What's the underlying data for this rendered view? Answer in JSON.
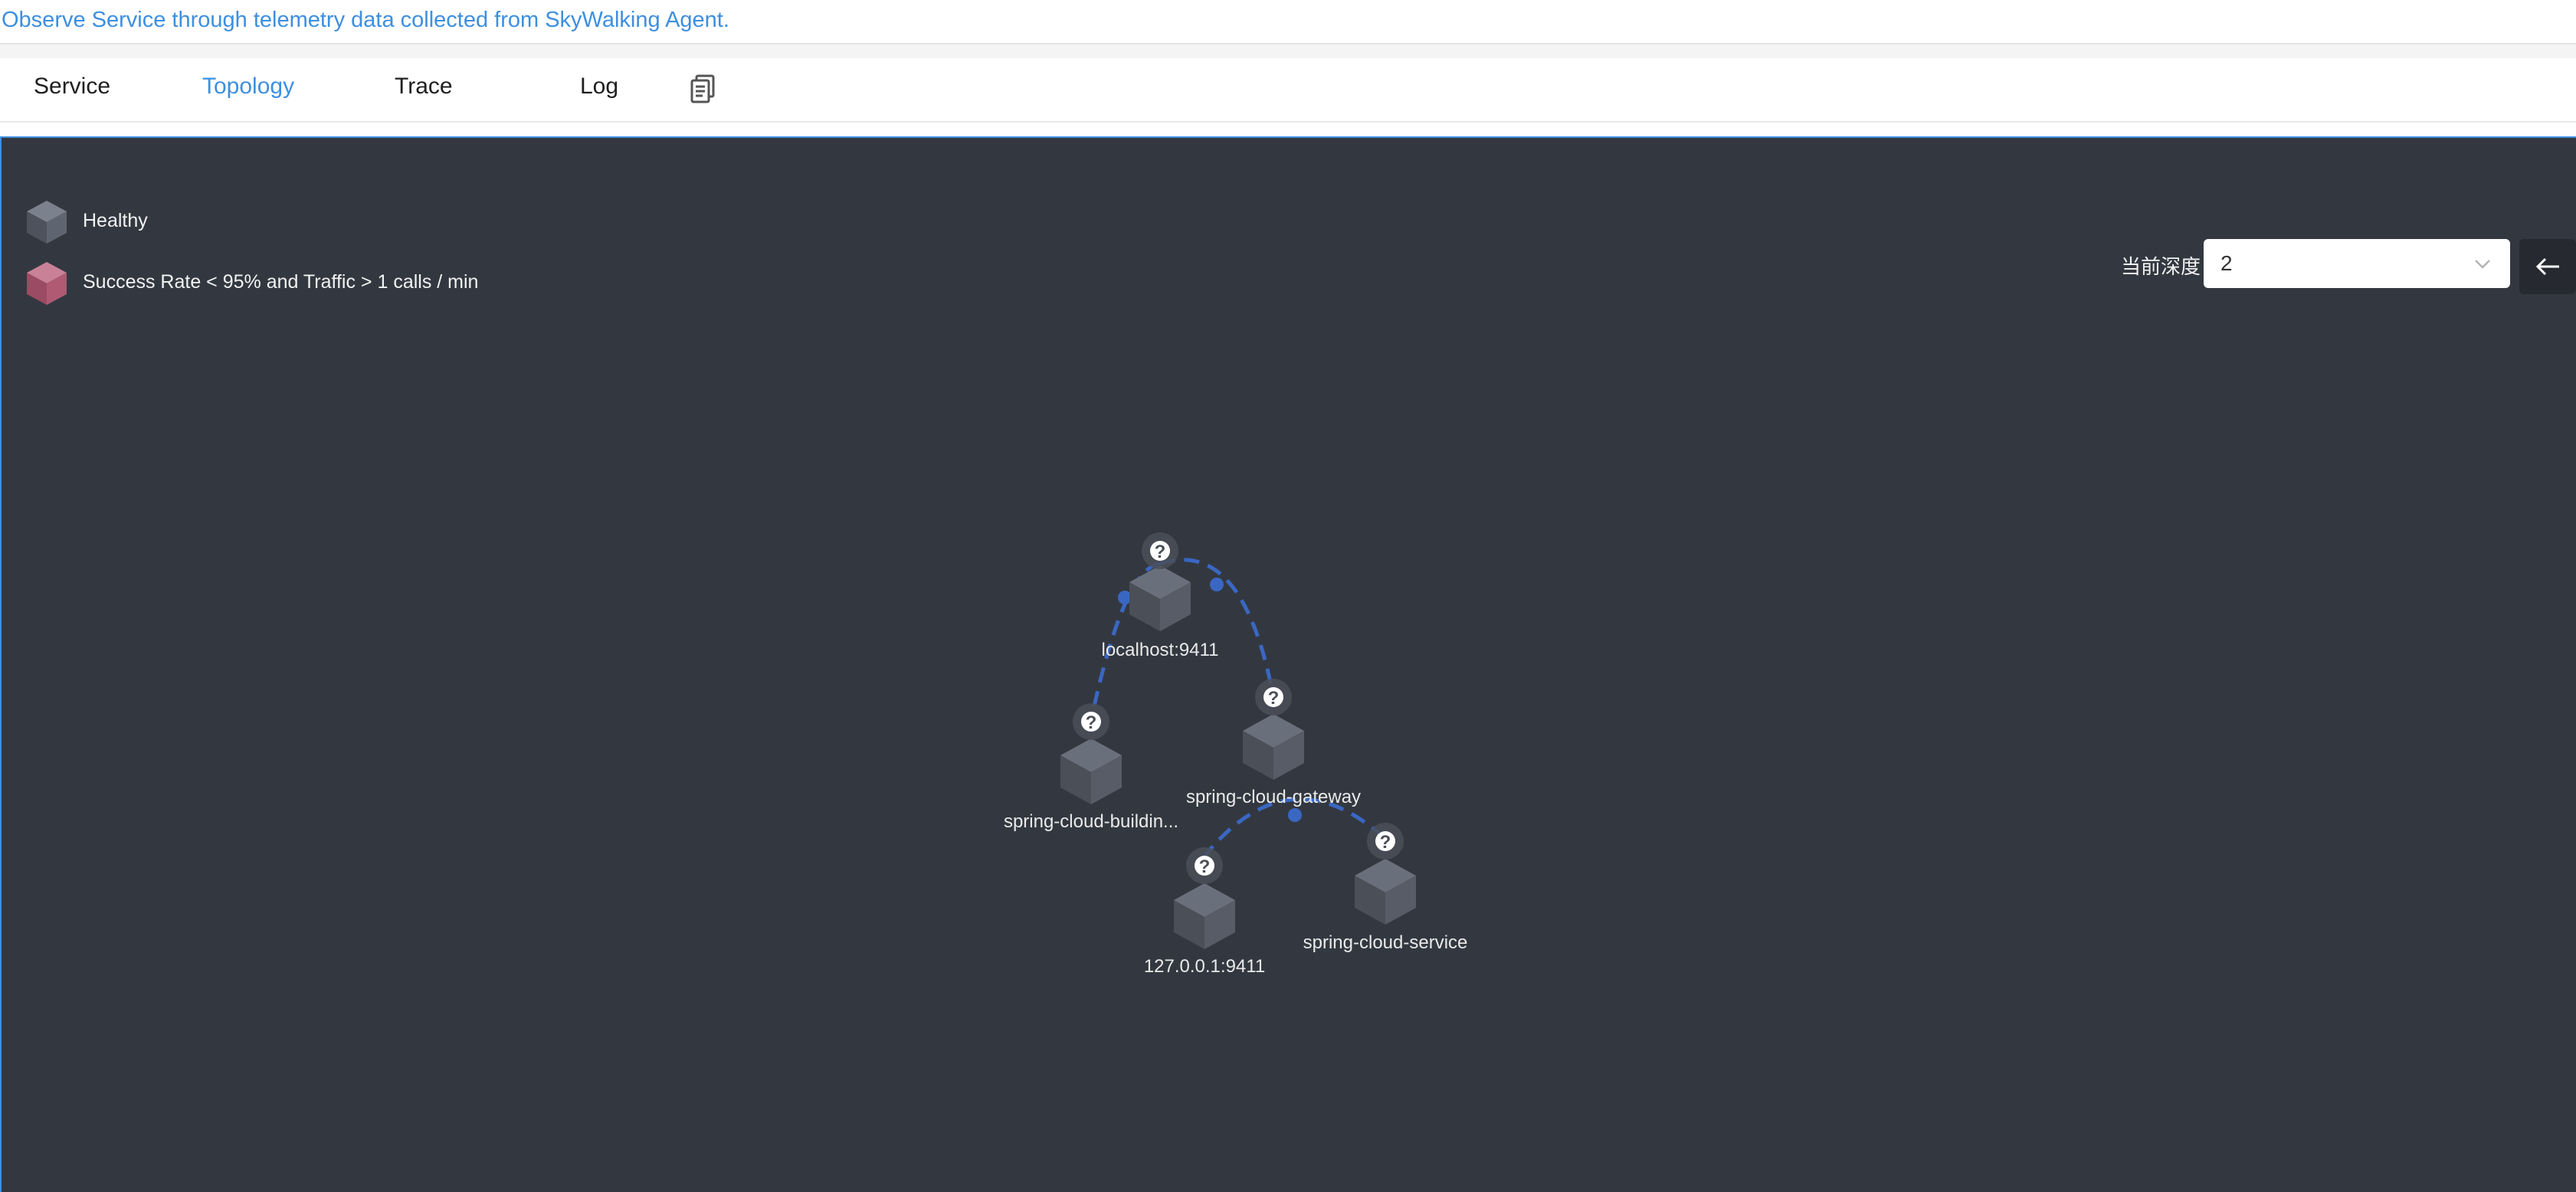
{
  "header": {
    "description": "Observe Service through telemetry data collected from SkyWalking Agent."
  },
  "tabs": [
    {
      "label": "Service",
      "active": false
    },
    {
      "label": "Topology",
      "active": true
    },
    {
      "label": "Trace",
      "active": false
    },
    {
      "label": "Log",
      "active": false
    }
  ],
  "tab_icon": "copy-document-icon",
  "legend": {
    "healthy": {
      "label": "Healthy",
      "color": "#5d6370"
    },
    "unhealthy": {
      "label": "Success Rate < 95% and Traffic > 1 calls / min",
      "color": "#b05a74"
    }
  },
  "depth": {
    "label": "当前深度",
    "value": "2"
  },
  "back_button": {
    "icon": "arrow-left-icon"
  },
  "topology": {
    "nodes": [
      {
        "id": "localhost",
        "label": "localhost:9411"
      },
      {
        "id": "building",
        "label": "spring-cloud-buildin..."
      },
      {
        "id": "gateway",
        "label": "spring-cloud-gateway"
      },
      {
        "id": "local127",
        "label": "127.0.0.1:9411"
      },
      {
        "id": "service",
        "label": "spring-cloud-service"
      }
    ],
    "badge_glyph": "?",
    "colors": {
      "background": "#333840",
      "edge": "#3a67c2",
      "cube": "#5d6370",
      "accent": "#3d8fe0"
    }
  }
}
